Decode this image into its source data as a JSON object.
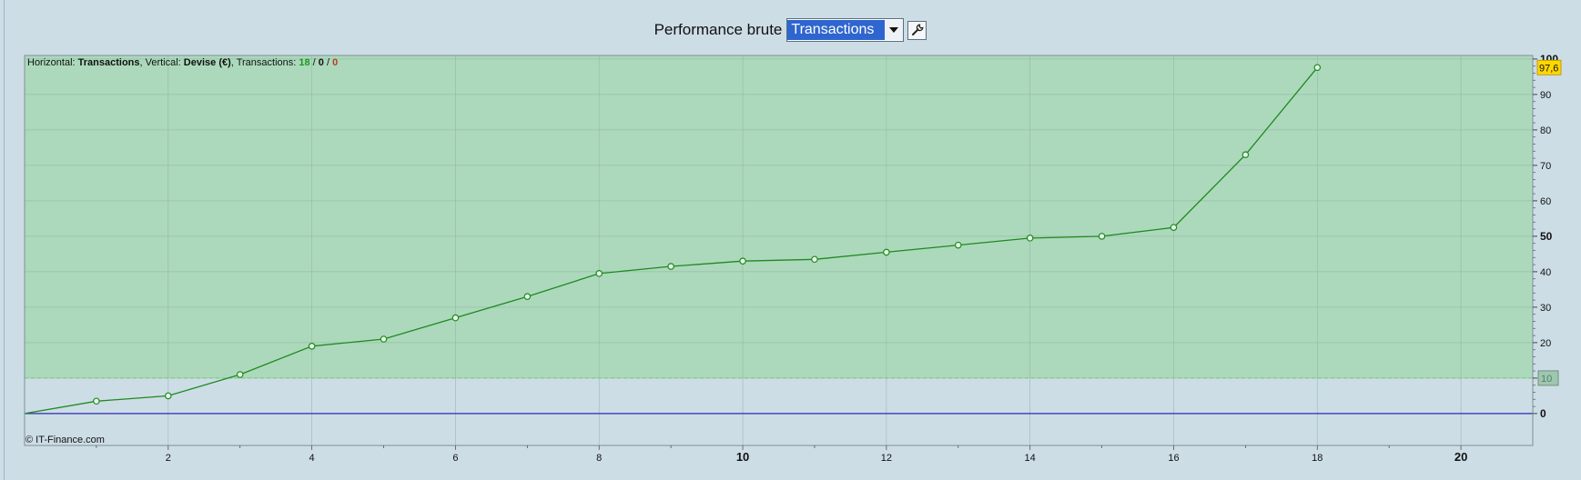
{
  "toolbar": {
    "label": "Performance brute",
    "select_value": "Transactions",
    "settings_icon": "wrench-icon",
    "dropdown_icon": "chevron-down-icon"
  },
  "info": {
    "h_prefix": "Horizontal: ",
    "h_value": "Transactions",
    "v_prefix": ", Vertical: ",
    "v_value": "Devise (€)",
    "t_prefix": ", Transactions: ",
    "count_total": "18",
    "sep1": " / ",
    "count_neutral": "0",
    "sep2": " / ",
    "count_loss": "0"
  },
  "copyright": "© IT-Finance.com",
  "colors": {
    "fill_above": "#acd9bc",
    "background": "#cddde6",
    "line": "#1e8a1e",
    "zero_line": "#2b2bb0",
    "threshold_line": "#6fcf6f",
    "last_value_badge": "#ffd700",
    "count_total_color": "#1a9a1a",
    "count_loss_color": "#c0392b"
  },
  "chart_data": {
    "type": "line",
    "x": [
      0,
      1,
      2,
      3,
      4,
      5,
      6,
      7,
      8,
      9,
      10,
      11,
      12,
      13,
      14,
      15,
      16,
      17,
      18
    ],
    "y": [
      0,
      3.5,
      5,
      11,
      19,
      21,
      27,
      33,
      39.5,
      41.5,
      43,
      43.5,
      45.5,
      47.5,
      49.5,
      50,
      52.5,
      73,
      97.6
    ],
    "xlim": [
      0,
      21
    ],
    "ylim": [
      -9,
      101
    ],
    "x_ticks": [
      2,
      4,
      6,
      8,
      10,
      12,
      14,
      16,
      18,
      20
    ],
    "x_tick_labels": [
      "2",
      "4",
      "6",
      "8",
      "10",
      "12",
      "14",
      "16",
      "18",
      "20"
    ],
    "y_ticks": [
      0,
      10,
      20,
      30,
      40,
      50,
      60,
      70,
      80,
      90,
      100
    ],
    "y_tick_labels": [
      "0",
      "10",
      "20",
      "30",
      "40",
      "50",
      "60",
      "70",
      "80",
      "90",
      "100"
    ],
    "threshold": 10,
    "threshold_label": "10",
    "last_value_label": "97,6",
    "grid": true
  }
}
